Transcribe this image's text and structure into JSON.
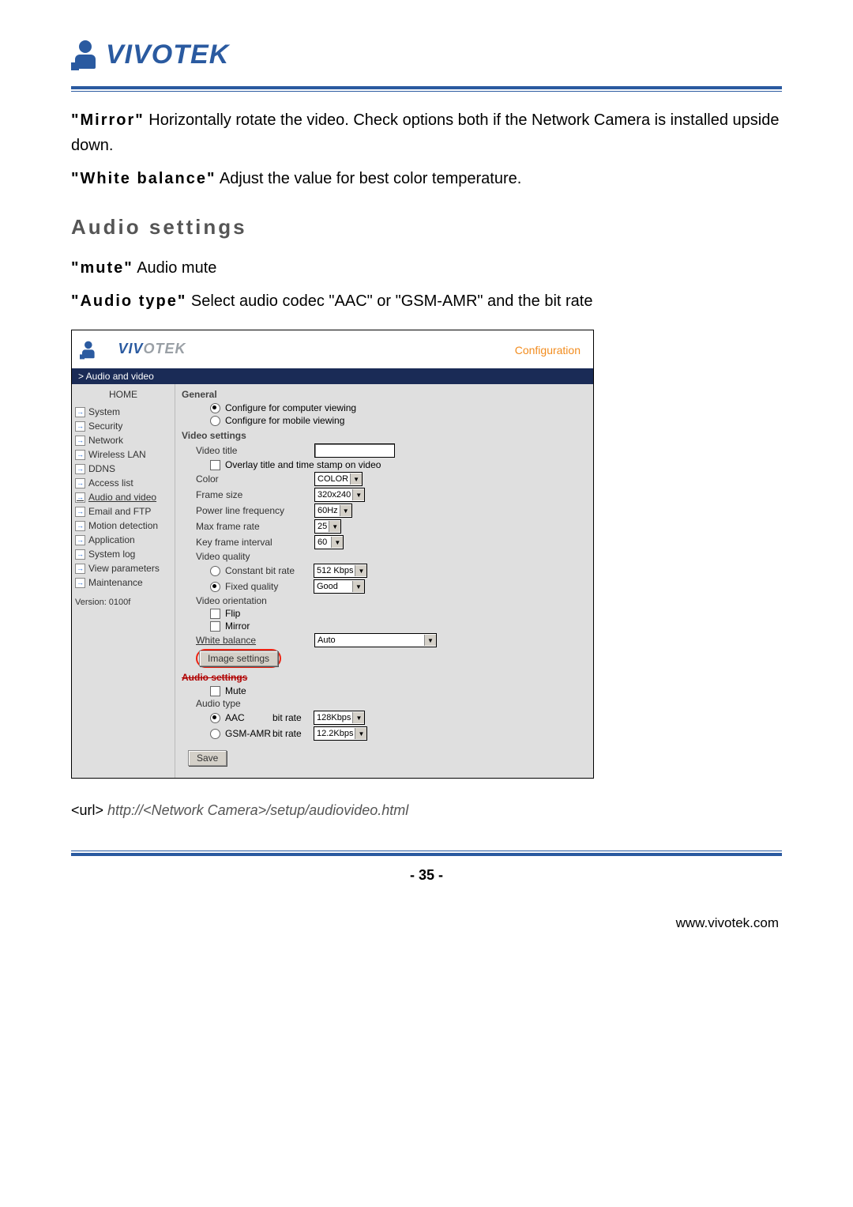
{
  "brand": "VIVOTEK",
  "doc": {
    "mirror_term": "\"Mirror\"",
    "mirror_desc": " Horizontally rotate the video. Check options both if the Network Camera is installed upside down.",
    "wb_term": "\"White balance\"",
    "wb_desc": " Adjust the value for best color temperature.",
    "heading": "Audio settings",
    "mute_term": "\"mute\"",
    "mute_desc": " Audio mute",
    "atype_term": "\"Audio type\"",
    "atype_desc": " Select audio codec \"AAC\" or \"GSM-AMR\" and the bit rate",
    "url_label": "<url> ",
    "url_value": "http://<Network Camera>/setup/audiovideo.html",
    "page_number": "- 35 -",
    "site": "www.vivotek.com"
  },
  "ui": {
    "config_label": "Configuration",
    "breadcrumb": "> Audio and video",
    "home": "HOME",
    "nav": [
      {
        "label": "System",
        "active": false
      },
      {
        "label": "Security",
        "active": false
      },
      {
        "label": "Network",
        "active": false
      },
      {
        "label": "Wireless LAN",
        "active": false
      },
      {
        "label": "DDNS",
        "active": false
      },
      {
        "label": "Access list",
        "active": false
      },
      {
        "label": "Audio and video",
        "active": true
      },
      {
        "label": "Email and FTP",
        "active": false
      },
      {
        "label": "Motion detection",
        "active": false
      },
      {
        "label": "Application",
        "active": false
      },
      {
        "label": "System log",
        "active": false
      },
      {
        "label": "View parameters",
        "active": false
      },
      {
        "label": "Maintenance",
        "active": false
      }
    ],
    "version": "Version: 0100f",
    "general": {
      "title": "General",
      "opt_computer": "Configure for computer viewing",
      "opt_mobile": "Configure for mobile viewing"
    },
    "video": {
      "title": "Video settings",
      "video_title_lbl": "Video title",
      "overlay_lbl": "Overlay title and time stamp on video",
      "color_lbl": "Color",
      "color_val": "COLOR",
      "frame_size_lbl": "Frame size",
      "frame_size_val": "320x240",
      "plf_lbl": "Power line frequency",
      "plf_val": "60Hz",
      "mfr_lbl": "Max frame rate",
      "mfr_val": "25",
      "kfi_lbl": "Key frame interval",
      "kfi_val": "60",
      "vq_lbl": "Video quality",
      "cbr_lbl": "Constant bit rate",
      "cbr_val": "512 Kbps",
      "fq_lbl": "Fixed quality",
      "fq_val": "Good",
      "orient_lbl": "Video orientation",
      "flip_lbl": "Flip",
      "mirror_lbl": "Mirror",
      "wb_lbl": "White balance",
      "wb_val": "Auto",
      "img_settings_btn": "Image settings"
    },
    "audio": {
      "title": "Audio settings",
      "mute_lbl": "Mute",
      "atype_lbl": "Audio type",
      "aac_lbl": "AAC",
      "gsm_lbl": "GSM-AMR",
      "bitrate_lbl": "bit rate",
      "aac_br": "128Kbps",
      "gsm_br": "12.2Kbps"
    },
    "save_btn": "Save"
  }
}
